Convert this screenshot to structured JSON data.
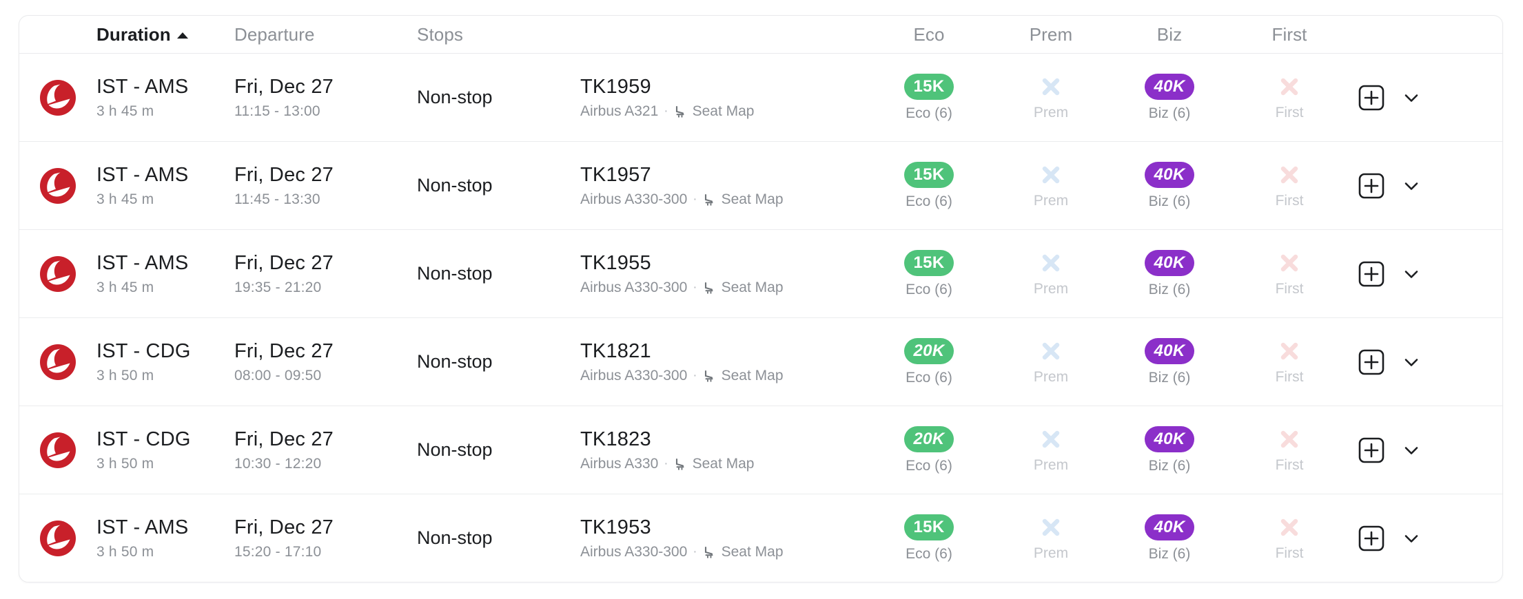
{
  "columns": {
    "duration": "Duration",
    "departure": "Departure",
    "stops": "Stops",
    "eco": "Eco",
    "prem": "Prem",
    "biz": "Biz",
    "first": "First"
  },
  "sort": {
    "active_column": "Duration",
    "direction": "asc",
    "caret_icon": "caret-up-icon"
  },
  "icons": {
    "airline_logo": "turkish-airlines-logo",
    "seat_map": "seat-icon",
    "add": "plus-square-icon",
    "expand": "chevron-down-icon",
    "unavailable": "x-icon"
  },
  "colors": {
    "eco_pill": "#4fc37a",
    "biz_pill": "#8b2fc9",
    "prem_x": "#d7e6f5",
    "first_x": "#f8dcdc",
    "logo_red": "#c8202a",
    "text_primary": "#1b1d20",
    "text_secondary": "#8c9096"
  },
  "labels": {
    "seat_map": "Seat Map",
    "separator": "·"
  },
  "rows": [
    {
      "route": "IST - AMS",
      "duration": "3 h 45 m",
      "date": "Fri, Dec 27",
      "times": "11:15 - 13:00",
      "stops": "Non-stop",
      "flight_no": "TK1959",
      "aircraft": "Airbus A321",
      "eco": {
        "available": true,
        "price": "15K",
        "label": "Eco (6)",
        "italic": false
      },
      "prem": {
        "available": false,
        "price": "",
        "label": "Prem",
        "italic": false
      },
      "biz": {
        "available": true,
        "price": "40K",
        "label": "Biz (6)",
        "italic": true
      },
      "first": {
        "available": false,
        "price": "",
        "label": "First",
        "italic": false
      }
    },
    {
      "route": "IST - AMS",
      "duration": "3 h 45 m",
      "date": "Fri, Dec 27",
      "times": "11:45 - 13:30",
      "stops": "Non-stop",
      "flight_no": "TK1957",
      "aircraft": "Airbus A330-300",
      "eco": {
        "available": true,
        "price": "15K",
        "label": "Eco (6)",
        "italic": false
      },
      "prem": {
        "available": false,
        "price": "",
        "label": "Prem",
        "italic": false
      },
      "biz": {
        "available": true,
        "price": "40K",
        "label": "Biz (6)",
        "italic": true
      },
      "first": {
        "available": false,
        "price": "",
        "label": "First",
        "italic": false
      }
    },
    {
      "route": "IST - AMS",
      "duration": "3 h 45 m",
      "date": "Fri, Dec 27",
      "times": "19:35 - 21:20",
      "stops": "Non-stop",
      "flight_no": "TK1955",
      "aircraft": "Airbus A330-300",
      "eco": {
        "available": true,
        "price": "15K",
        "label": "Eco (6)",
        "italic": false
      },
      "prem": {
        "available": false,
        "price": "",
        "label": "Prem",
        "italic": false
      },
      "biz": {
        "available": true,
        "price": "40K",
        "label": "Biz (6)",
        "italic": true
      },
      "first": {
        "available": false,
        "price": "",
        "label": "First",
        "italic": false
      }
    },
    {
      "route": "IST - CDG",
      "duration": "3 h 50 m",
      "date": "Fri, Dec 27",
      "times": "08:00 - 09:50",
      "stops": "Non-stop",
      "flight_no": "TK1821",
      "aircraft": "Airbus A330-300",
      "eco": {
        "available": true,
        "price": "20K",
        "label": "Eco (6)",
        "italic": true
      },
      "prem": {
        "available": false,
        "price": "",
        "label": "Prem",
        "italic": false
      },
      "biz": {
        "available": true,
        "price": "40K",
        "label": "Biz (6)",
        "italic": true
      },
      "first": {
        "available": false,
        "price": "",
        "label": "First",
        "italic": false
      }
    },
    {
      "route": "IST - CDG",
      "duration": "3 h 50 m",
      "date": "Fri, Dec 27",
      "times": "10:30 - 12:20",
      "stops": "Non-stop",
      "flight_no": "TK1823",
      "aircraft": "Airbus A330",
      "eco": {
        "available": true,
        "price": "20K",
        "label": "Eco (6)",
        "italic": true
      },
      "prem": {
        "available": false,
        "price": "",
        "label": "Prem",
        "italic": false
      },
      "biz": {
        "available": true,
        "price": "40K",
        "label": "Biz (6)",
        "italic": true
      },
      "first": {
        "available": false,
        "price": "",
        "label": "First",
        "italic": false
      }
    },
    {
      "route": "IST - AMS",
      "duration": "3 h 50 m",
      "date": "Fri, Dec 27",
      "times": "15:20 - 17:10",
      "stops": "Non-stop",
      "flight_no": "TK1953",
      "aircraft": "Airbus A330-300",
      "eco": {
        "available": true,
        "price": "15K",
        "label": "Eco (6)",
        "italic": false
      },
      "prem": {
        "available": false,
        "price": "",
        "label": "Prem",
        "italic": false
      },
      "biz": {
        "available": true,
        "price": "40K",
        "label": "Biz (6)",
        "italic": true
      },
      "first": {
        "available": false,
        "price": "",
        "label": "First",
        "italic": false
      }
    }
  ]
}
